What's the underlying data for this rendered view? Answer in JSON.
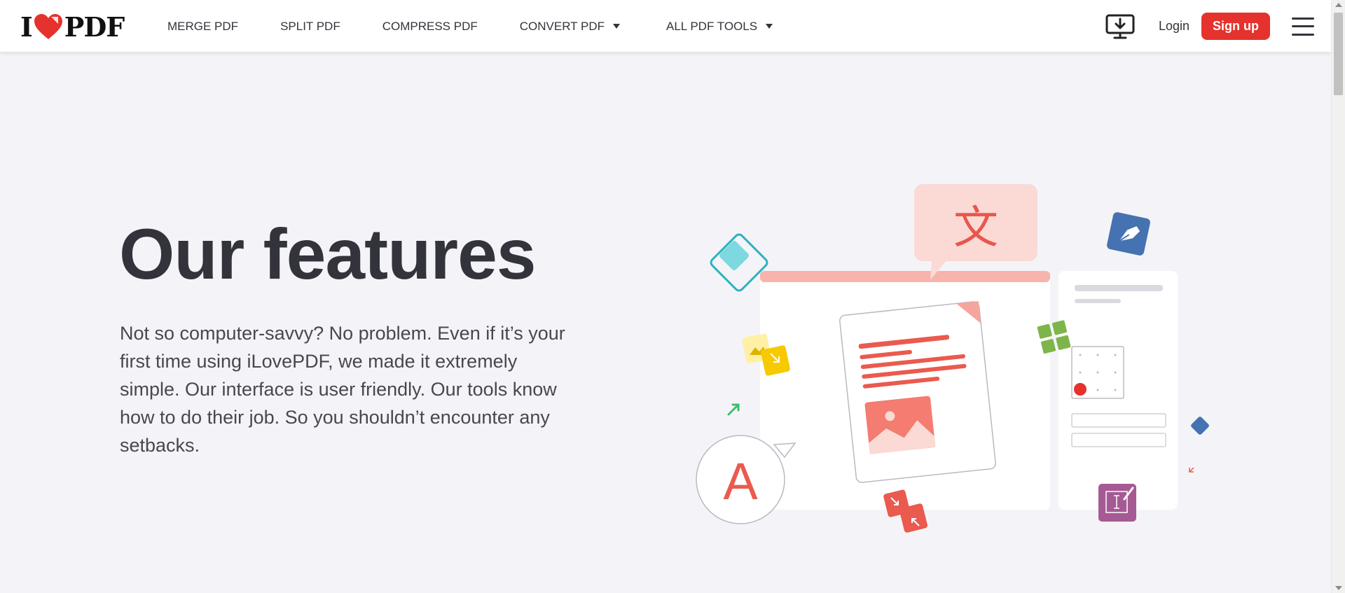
{
  "brand": {
    "logo_left": "I",
    "logo_right": "PDF",
    "accent": "#e5322d"
  },
  "nav": {
    "items": [
      {
        "label": "MERGE PDF",
        "dropdown": false
      },
      {
        "label": "SPLIT PDF",
        "dropdown": false
      },
      {
        "label": "COMPRESS PDF",
        "dropdown": false
      },
      {
        "label": "CONVERT PDF",
        "dropdown": true
      },
      {
        "label": "ALL PDF TOOLS",
        "dropdown": true
      }
    ]
  },
  "header_actions": {
    "download_icon": "desktop-download-icon",
    "login": "Login",
    "signup": "Sign up",
    "menu_icon": "hamburger-menu-icon"
  },
  "hero": {
    "title": "Our features",
    "description": "Not so computer-savvy? No problem. Even if it’s your first time using iLovePDF, we made it extremely simple. Our interface is user friendly. Our tools know how to do their job. So you shouldn’t encounter any setbacks."
  },
  "illustration": {
    "translate_glyph": "文",
    "letter_glyph": "A",
    "icons": [
      "translate-icon",
      "pen-nib-icon",
      "edit-text-icon",
      "compress-arrows-icon",
      "image-icon",
      "signature-icon"
    ]
  }
}
